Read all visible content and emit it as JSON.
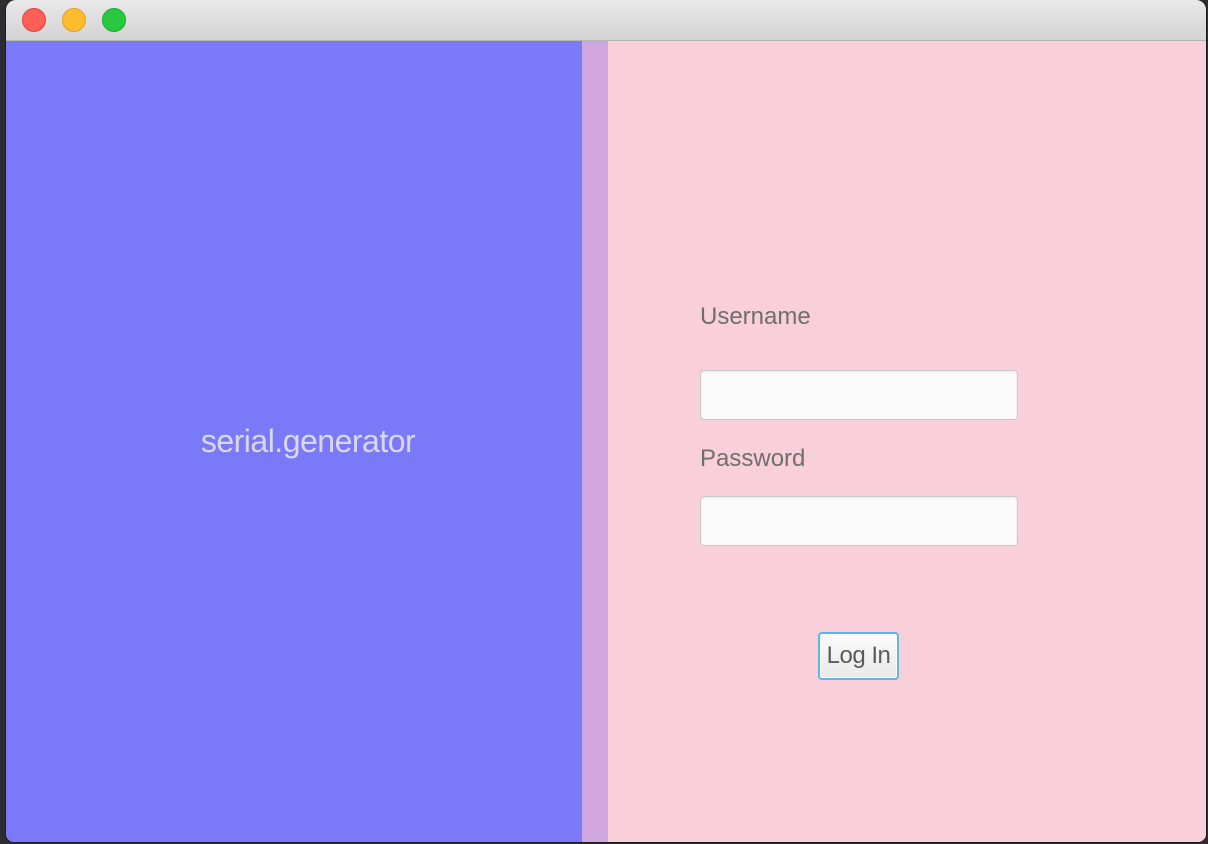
{
  "window": {
    "buttons": [
      {
        "name": "close",
        "color": "#fe5f57"
      },
      {
        "name": "minimize",
        "color": "#febc2e"
      },
      {
        "name": "zoom",
        "color": "#28c840"
      }
    ]
  },
  "colors": {
    "left_pane": "#7a7af8",
    "divider": "#d0a6de",
    "right_pane": "#f9d0da",
    "button_focus": "#5fb4e6"
  },
  "left_pane": {
    "app_name": "serial.generator"
  },
  "login_form": {
    "username_label": "Username",
    "username_value": "",
    "password_label": "Password",
    "password_value": "",
    "login_button_label": "Log In"
  }
}
